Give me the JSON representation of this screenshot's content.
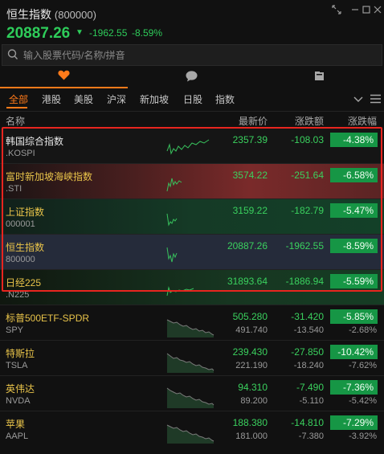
{
  "header": {
    "title": "恒生指数",
    "code": "(800000)",
    "price": "20887.26",
    "arrow": "▼",
    "change": "-1962.55",
    "change_pct": "-8.59%"
  },
  "window_controls": [
    "expand-icon",
    "minimize-icon",
    "restore-icon",
    "close-icon"
  ],
  "search": {
    "placeholder": "输入股票代码/名称/拼音"
  },
  "icon_tabs": [
    "heart-icon",
    "chat-bubble-icon",
    "news-icon"
  ],
  "market_tabs": [
    "全部",
    "港股",
    "美股",
    "沪深",
    "新加坡",
    "日股",
    "指数"
  ],
  "columns": {
    "name": "名称",
    "last": "最新价",
    "change": "涨跌额",
    "pct": "涨跌幅"
  },
  "accent_color": "#ff7a1a",
  "up_down_color": "#3ad15e",
  "rows": [
    {
      "name": "韩国综合指数",
      "sub": ".KOSPI",
      "last": "2357.39",
      "change": "-108.03",
      "pct": "-4.38%"
    },
    {
      "name": "富时新加坡海峡指数",
      "sub": ".STI",
      "last": "3574.22",
      "change": "-251.64",
      "pct": "-6.58%"
    },
    {
      "name": "上证指数",
      "sub": "000001",
      "last": "3159.22",
      "change": "-182.79",
      "pct": "-5.47%"
    },
    {
      "name": "恒生指数",
      "sub": "800000",
      "last": "20887.26",
      "change": "-1962.55",
      "pct": "-8.59%"
    },
    {
      "name": "日经225",
      "sub": ".N225",
      "last": "31893.64",
      "change": "-1886.94",
      "pct": "-5.59%"
    },
    {
      "name": "标普500ETF-SPDR",
      "sub": "SPY",
      "last": "505.280",
      "change": "-31.420",
      "pct": "-5.85%",
      "last2": "491.740",
      "change2": "-13.540",
      "pct2": "-2.68%"
    },
    {
      "name": "特斯拉",
      "sub": "TSLA",
      "last": "239.430",
      "change": "-27.850",
      "pct": "-10.42%",
      "last2": "221.190",
      "change2": "-18.240",
      "pct2": "-7.62%"
    },
    {
      "name": "英伟达",
      "sub": "NVDA",
      "last": "94.310",
      "change": "-7.490",
      "pct": "-7.36%",
      "last2": "89.200",
      "change2": "-5.110",
      "pct2": "-5.42%"
    },
    {
      "name": "苹果",
      "sub": "AAPL",
      "last": "188.380",
      "change": "-14.810",
      "pct": "-7.29%",
      "last2": "181.000",
      "change2": "-7.380",
      "pct2": "-3.92%"
    }
  ]
}
